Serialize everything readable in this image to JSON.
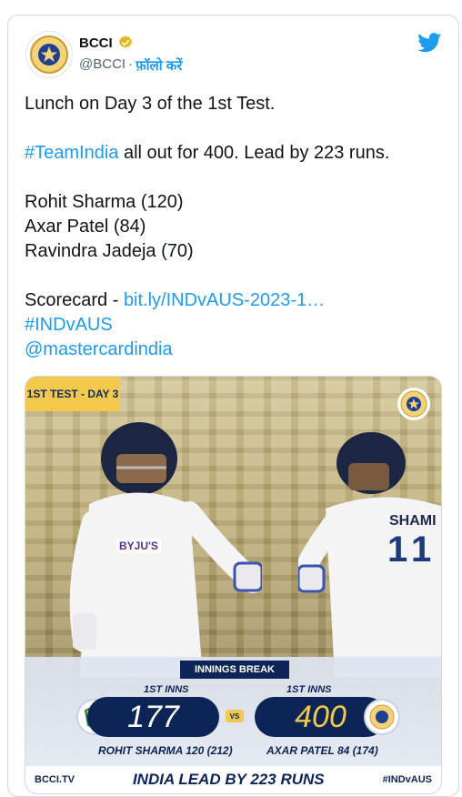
{
  "header": {
    "name": "BCCI",
    "handle": "@BCCI",
    "separator": "·",
    "follow_label": "फ़ॉलो करें",
    "avatar_icon": "bcci-logo-icon",
    "verified_icon": "verified-badge-icon",
    "brand_icon": "twitter-bird-icon"
  },
  "tweet": {
    "line1": "Lunch on Day 3 of the 1st Test.",
    "hashtag_teamindia": "#TeamIndia",
    "line2_rest": " all out for 400. Lead by 223 runs.",
    "player1": "Rohit Sharma (120)",
    "player2": "Axar Patel (84)",
    "player3": "Ravindra Jadeja (70)",
    "scorecard_label": "Scorecard - ",
    "scorecard_link": "bit.ly/INDvAUS-2023-1…",
    "hashtag_indvaus": "#INDvAUS",
    "mention": "@mastercardindia"
  },
  "image": {
    "test_tag": "1ST TEST - DAY 3",
    "shirt_name": "SHAMI",
    "shirt_number": "11",
    "sponsor": "BYJU'S",
    "innings_break": "INNINGS BREAK",
    "aus_inns_label": "1ST INNS",
    "ind_inns_label": "1ST INNS",
    "aus_score": "177",
    "ind_score": "400",
    "vs": "VS",
    "aus_top": "ROHIT SHARMA  120 (212)",
    "ind_top": "AXAR PATEL 84 (174)",
    "site": "BCCI.TV",
    "lead_text": "INDIA LEAD BY 223 RUNS",
    "footer_hashtag": "#INDvAUS"
  },
  "colors": {
    "link": "#1d9bf0",
    "navy": "#0d2457",
    "gold": "#f2c94c"
  }
}
